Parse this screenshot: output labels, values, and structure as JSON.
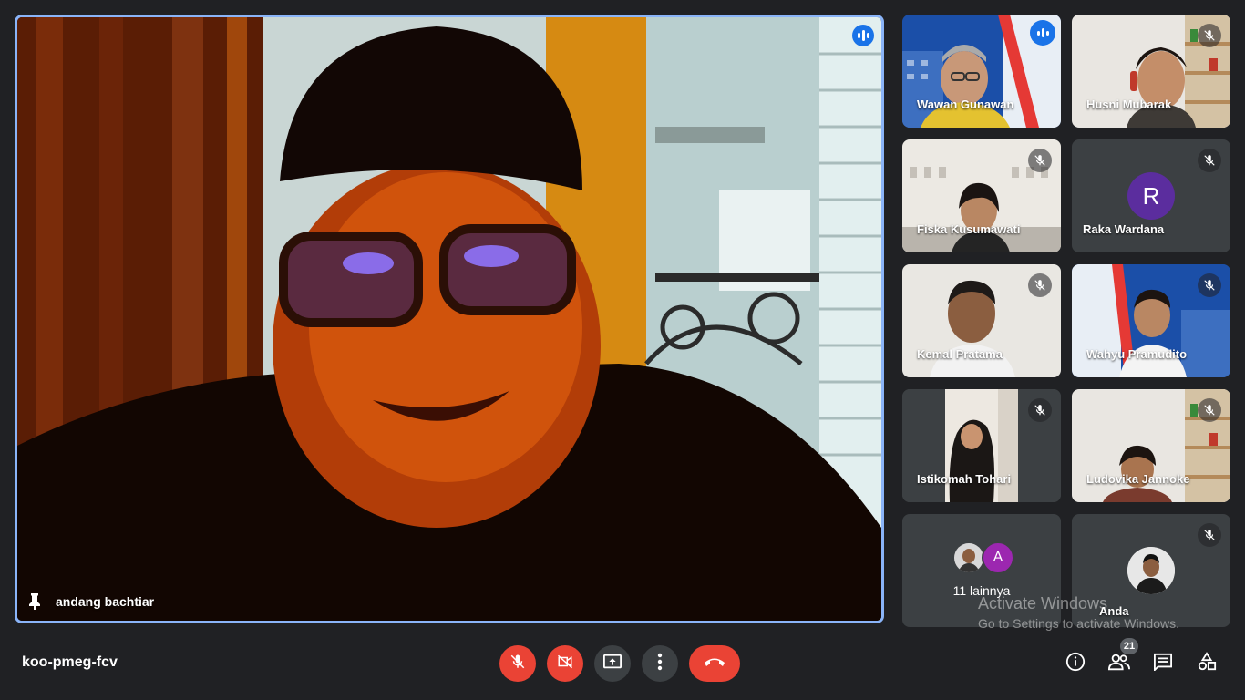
{
  "meeting": {
    "code": "koo-pmeg-fcv",
    "participant_count": "21"
  },
  "main_speaker": {
    "name": "andang bachtiar",
    "pinned": true,
    "speaking": true
  },
  "tiles": [
    {
      "name": "Wawan Gunawan",
      "muted": false,
      "speaking": true,
      "type": "video"
    },
    {
      "name": "Husni Mubarak",
      "muted": true,
      "type": "video"
    },
    {
      "name": "Fiska Kusumawati",
      "muted": true,
      "type": "video"
    },
    {
      "name": "Raka Wardana",
      "muted": true,
      "type": "avatar",
      "initial": "R",
      "avatar_color": "#5b2d9e"
    },
    {
      "name": "Kemal Pratama",
      "muted": true,
      "type": "video"
    },
    {
      "name": "Wahyu Pramudito",
      "muted": true,
      "type": "video"
    },
    {
      "name": "Istikomah Tohari",
      "muted": true,
      "type": "video"
    },
    {
      "name": "Ludovika Jannoke",
      "muted": true,
      "type": "video"
    },
    {
      "name": "11 lainnya",
      "type": "more",
      "initial": "A",
      "avatar_color": "#9c27b0"
    },
    {
      "name": "Anda",
      "muted": true,
      "type": "self"
    }
  ],
  "watermark": {
    "title": "Activate Windows",
    "subtitle": "Go to Settings to activate Windows."
  },
  "controls": {
    "mic": {
      "icon": "mic-off-icon",
      "state": "off"
    },
    "camera": {
      "icon": "camera-off-icon",
      "state": "off"
    },
    "present": {
      "icon": "present-screen-icon"
    },
    "more": {
      "icon": "more-options-icon"
    },
    "end": {
      "icon": "end-call-icon"
    }
  },
  "right_controls": [
    "info-icon",
    "people-icon",
    "chat-icon",
    "activities-icon"
  ],
  "colors": {
    "background": "#202124",
    "active_border": "#8ab4f8",
    "danger": "#ea4335",
    "tile_bg": "#3c4043",
    "speaking": "#1a73e8"
  }
}
